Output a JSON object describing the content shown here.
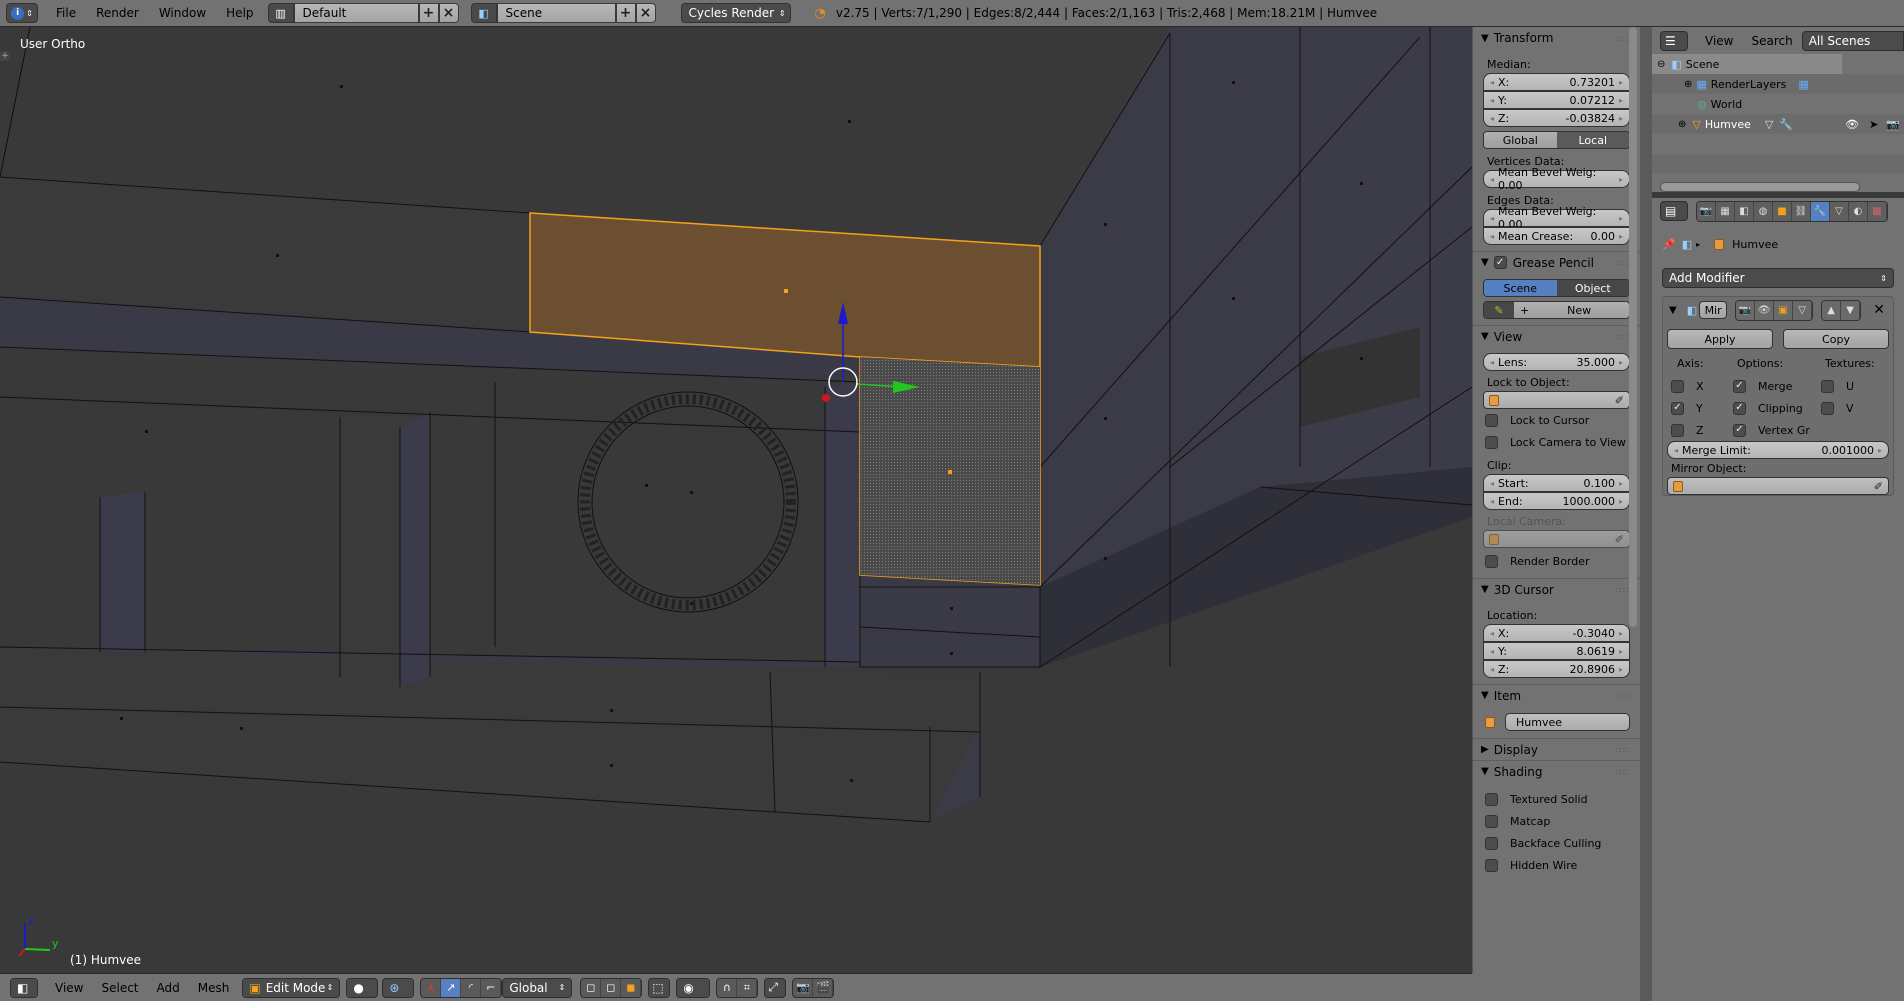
{
  "topbar": {
    "menus": [
      "File",
      "Render",
      "Window",
      "Help"
    ],
    "screen_layout": "Default",
    "scene": "Scene",
    "render_engine": "Cycles Render",
    "info": "v2.75 | Verts:7/1,290 | Edges:8/2,444 | Faces:2/1,163 | Tris:2,468 | Mem:18.21M | Humvee"
  },
  "viewport": {
    "title": "User Ortho",
    "object_label": "(1) Humvee",
    "axis_labels": {
      "z": "z",
      "y": "y"
    },
    "colors": {
      "background": "#393939",
      "face": "#3b3b47",
      "selected_face": "#6b4f30",
      "selected_edge": "#f5a11a",
      "gizmo_z": "#1a1acc",
      "gizmo_y": "#1ec81e",
      "gizmo_x": "#cc1a1a"
    }
  },
  "bottombar": {
    "menus": [
      "View",
      "Select",
      "Add",
      "Mesh"
    ],
    "mode": "Edit Mode",
    "orientation": "Global"
  },
  "npanel": {
    "transform": {
      "title": "Transform",
      "median_label": "Median:",
      "x_label": "X:",
      "x": "0.73201",
      "y_label": "Y:",
      "y": "0.07212",
      "z_label": "Z:",
      "z": "-0.03824",
      "global": "Global",
      "local": "Local",
      "vertices_data": "Vertices Data:",
      "vert_bevel": "Mean Bevel Weig: 0.00",
      "edges_data": "Edges Data:",
      "edge_bevel": "Mean Bevel Weig: 0.00",
      "crease_label": "Mean Crease:",
      "crease": "0.00"
    },
    "grease_pencil": {
      "title": "Grease Pencil",
      "scene": "Scene",
      "object": "Object",
      "new": "New"
    },
    "view": {
      "title": "View",
      "lens_label": "Lens:",
      "lens": "35.000",
      "lock_to_object": "Lock to Object:",
      "lock_to_cursor": "Lock to Cursor",
      "lock_camera": "Lock Camera to View",
      "clip": "Clip:",
      "start_label": "Start:",
      "start": "0.100",
      "end_label": "End:",
      "end": "1000.000",
      "local_camera": "Local Camera:",
      "render_border": "Render Border"
    },
    "cursor": {
      "title": "3D Cursor",
      "location": "Location:",
      "x_label": "X:",
      "x": "-0.3040",
      "y_label": "Y:",
      "y": "8.0619",
      "z_label": "Z:",
      "z": "20.8906"
    },
    "item": {
      "title": "Item",
      "name": "Humvee"
    },
    "display": {
      "title": "Display"
    },
    "shading": {
      "title": "Shading",
      "options": [
        "Textured Solid",
        "Matcap",
        "Backface Culling",
        "Hidden Wire"
      ]
    }
  },
  "outliner": {
    "menus": [
      "View",
      "Search"
    ],
    "filter": "All Scenes",
    "rows": [
      {
        "label": "Scene"
      },
      {
        "label": "RenderLayers"
      },
      {
        "label": "World"
      },
      {
        "label": "Humvee"
      }
    ]
  },
  "properties": {
    "breadcrumb_object": "Humvee",
    "add_modifier": "Add Modifier",
    "modifier_name": "Mir",
    "apply": "Apply",
    "copy": "Copy",
    "axis_label": "Axis:",
    "options_label": "Options:",
    "textures_label": "Textures:",
    "axis": [
      {
        "label": "X",
        "checked": false
      },
      {
        "label": "Y",
        "checked": true
      },
      {
        "label": "Z",
        "checked": false
      }
    ],
    "options": [
      {
        "label": "Merge",
        "checked": true
      },
      {
        "label": "Clipping",
        "checked": true
      },
      {
        "label": "Vertex Gr",
        "checked": true
      }
    ],
    "textures": [
      {
        "label": "U",
        "checked": false
      },
      {
        "label": "V",
        "checked": false
      }
    ],
    "merge_limit_label": "Merge Limit:",
    "merge_limit": "0.001000",
    "mirror_object": "Mirror Object:"
  }
}
